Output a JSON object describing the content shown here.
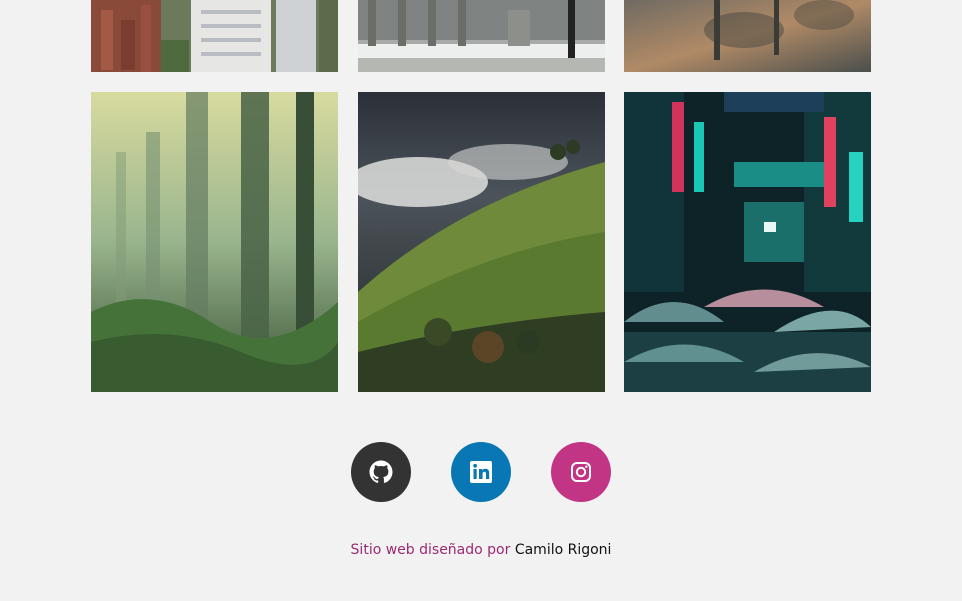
{
  "gallery": {
    "top_row": [
      {
        "alt": "city-buildings-photo"
      },
      {
        "alt": "snowy-balcony-photo"
      },
      {
        "alt": "water-reflection-photo"
      }
    ],
    "bottom_row": [
      {
        "alt": "foggy-forest-photo"
      },
      {
        "alt": "misty-hills-photo"
      },
      {
        "alt": "neon-street-umbrellas-photo"
      }
    ]
  },
  "social": {
    "items": [
      {
        "name": "GitHub",
        "icon": "github-icon",
        "color": "#333333"
      },
      {
        "name": "LinkedIn",
        "icon": "linkedin-icon",
        "color": "#0a77b5"
      },
      {
        "name": "Instagram",
        "icon": "instagram-icon",
        "color": "#c13584"
      }
    ]
  },
  "footer": {
    "credit_prefix": "Sitio web diseñado por ",
    "author": "Camilo Rigoni",
    "prefix_color": "#9b2a73",
    "author_color": "#111111"
  }
}
